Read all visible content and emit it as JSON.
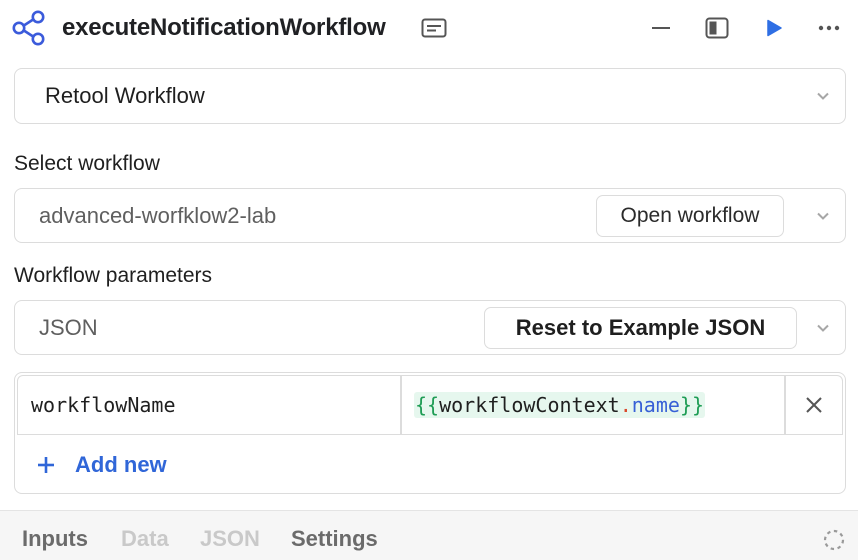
{
  "header": {
    "title": "executeNotificationWorkflow",
    "icons": {
      "share": "share-nodes-icon",
      "notes": "notes-icon",
      "minimize": "minimize-icon",
      "panel": "panel-icon",
      "run": "play-icon",
      "more": "more-icon"
    },
    "accent_color": "#3b5bdb"
  },
  "resource": {
    "selected": "Retool Workflow"
  },
  "select_workflow": {
    "label": "Select workflow",
    "selected": "advanced-worfklow2-lab",
    "open_button": "Open workflow"
  },
  "workflow_parameters": {
    "label": "Workflow parameters",
    "format": "JSON",
    "reset_button": "Reset to Example JSON",
    "rows": [
      {
        "key": "workflowName",
        "value_parts": {
          "open": "{{",
          "object": "workflowContext",
          "dot": ".",
          "property": "name",
          "close": "}}"
        }
      }
    ],
    "add_new": "Add new"
  },
  "footer": {
    "tabs": [
      "Inputs",
      "Data",
      "JSON",
      "Settings"
    ],
    "active_tabs": [
      "Inputs",
      "Settings"
    ],
    "status_icon": "spinner-icon"
  },
  "colors": {
    "link_blue": "#3066d8",
    "expr_green": "#1f9d55",
    "expr_bg": "#e6f7ee"
  }
}
